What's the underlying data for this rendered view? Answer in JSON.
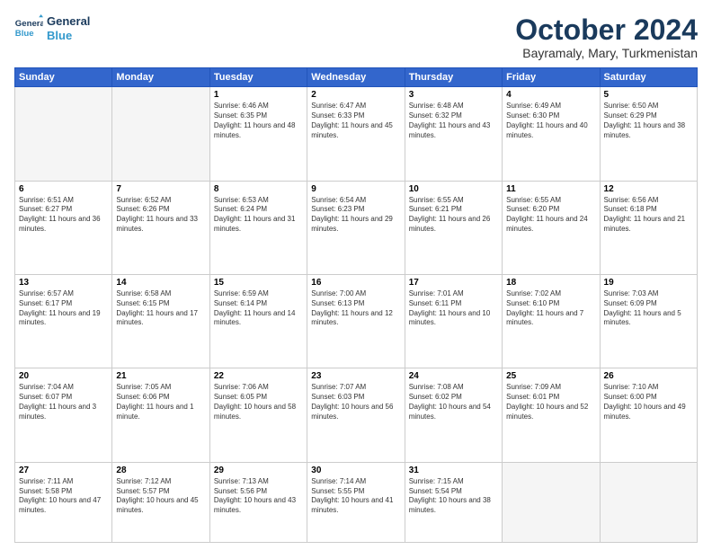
{
  "logo": {
    "line1": "General",
    "line2": "Blue"
  },
  "title": "October 2024",
  "subtitle": "Bayramaly, Mary, Turkmenistan",
  "headers": [
    "Sunday",
    "Monday",
    "Tuesday",
    "Wednesday",
    "Thursday",
    "Friday",
    "Saturday"
  ],
  "weeks": [
    [
      {
        "day": "",
        "info": ""
      },
      {
        "day": "",
        "info": ""
      },
      {
        "day": "1",
        "info": "Sunrise: 6:46 AM\nSunset: 6:35 PM\nDaylight: 11 hours and 48 minutes."
      },
      {
        "day": "2",
        "info": "Sunrise: 6:47 AM\nSunset: 6:33 PM\nDaylight: 11 hours and 45 minutes."
      },
      {
        "day": "3",
        "info": "Sunrise: 6:48 AM\nSunset: 6:32 PM\nDaylight: 11 hours and 43 minutes."
      },
      {
        "day": "4",
        "info": "Sunrise: 6:49 AM\nSunset: 6:30 PM\nDaylight: 11 hours and 40 minutes."
      },
      {
        "day": "5",
        "info": "Sunrise: 6:50 AM\nSunset: 6:29 PM\nDaylight: 11 hours and 38 minutes."
      }
    ],
    [
      {
        "day": "6",
        "info": "Sunrise: 6:51 AM\nSunset: 6:27 PM\nDaylight: 11 hours and 36 minutes."
      },
      {
        "day": "7",
        "info": "Sunrise: 6:52 AM\nSunset: 6:26 PM\nDaylight: 11 hours and 33 minutes."
      },
      {
        "day": "8",
        "info": "Sunrise: 6:53 AM\nSunset: 6:24 PM\nDaylight: 11 hours and 31 minutes."
      },
      {
        "day": "9",
        "info": "Sunrise: 6:54 AM\nSunset: 6:23 PM\nDaylight: 11 hours and 29 minutes."
      },
      {
        "day": "10",
        "info": "Sunrise: 6:55 AM\nSunset: 6:21 PM\nDaylight: 11 hours and 26 minutes."
      },
      {
        "day": "11",
        "info": "Sunrise: 6:55 AM\nSunset: 6:20 PM\nDaylight: 11 hours and 24 minutes."
      },
      {
        "day": "12",
        "info": "Sunrise: 6:56 AM\nSunset: 6:18 PM\nDaylight: 11 hours and 21 minutes."
      }
    ],
    [
      {
        "day": "13",
        "info": "Sunrise: 6:57 AM\nSunset: 6:17 PM\nDaylight: 11 hours and 19 minutes."
      },
      {
        "day": "14",
        "info": "Sunrise: 6:58 AM\nSunset: 6:15 PM\nDaylight: 11 hours and 17 minutes."
      },
      {
        "day": "15",
        "info": "Sunrise: 6:59 AM\nSunset: 6:14 PM\nDaylight: 11 hours and 14 minutes."
      },
      {
        "day": "16",
        "info": "Sunrise: 7:00 AM\nSunset: 6:13 PM\nDaylight: 11 hours and 12 minutes."
      },
      {
        "day": "17",
        "info": "Sunrise: 7:01 AM\nSunset: 6:11 PM\nDaylight: 11 hours and 10 minutes."
      },
      {
        "day": "18",
        "info": "Sunrise: 7:02 AM\nSunset: 6:10 PM\nDaylight: 11 hours and 7 minutes."
      },
      {
        "day": "19",
        "info": "Sunrise: 7:03 AM\nSunset: 6:09 PM\nDaylight: 11 hours and 5 minutes."
      }
    ],
    [
      {
        "day": "20",
        "info": "Sunrise: 7:04 AM\nSunset: 6:07 PM\nDaylight: 11 hours and 3 minutes."
      },
      {
        "day": "21",
        "info": "Sunrise: 7:05 AM\nSunset: 6:06 PM\nDaylight: 11 hours and 1 minute."
      },
      {
        "day": "22",
        "info": "Sunrise: 7:06 AM\nSunset: 6:05 PM\nDaylight: 10 hours and 58 minutes."
      },
      {
        "day": "23",
        "info": "Sunrise: 7:07 AM\nSunset: 6:03 PM\nDaylight: 10 hours and 56 minutes."
      },
      {
        "day": "24",
        "info": "Sunrise: 7:08 AM\nSunset: 6:02 PM\nDaylight: 10 hours and 54 minutes."
      },
      {
        "day": "25",
        "info": "Sunrise: 7:09 AM\nSunset: 6:01 PM\nDaylight: 10 hours and 52 minutes."
      },
      {
        "day": "26",
        "info": "Sunrise: 7:10 AM\nSunset: 6:00 PM\nDaylight: 10 hours and 49 minutes."
      }
    ],
    [
      {
        "day": "27",
        "info": "Sunrise: 7:11 AM\nSunset: 5:58 PM\nDaylight: 10 hours and 47 minutes."
      },
      {
        "day": "28",
        "info": "Sunrise: 7:12 AM\nSunset: 5:57 PM\nDaylight: 10 hours and 45 minutes."
      },
      {
        "day": "29",
        "info": "Sunrise: 7:13 AM\nSunset: 5:56 PM\nDaylight: 10 hours and 43 minutes."
      },
      {
        "day": "30",
        "info": "Sunrise: 7:14 AM\nSunset: 5:55 PM\nDaylight: 10 hours and 41 minutes."
      },
      {
        "day": "31",
        "info": "Sunrise: 7:15 AM\nSunset: 5:54 PM\nDaylight: 10 hours and 38 minutes."
      },
      {
        "day": "",
        "info": ""
      },
      {
        "day": "",
        "info": ""
      }
    ]
  ]
}
